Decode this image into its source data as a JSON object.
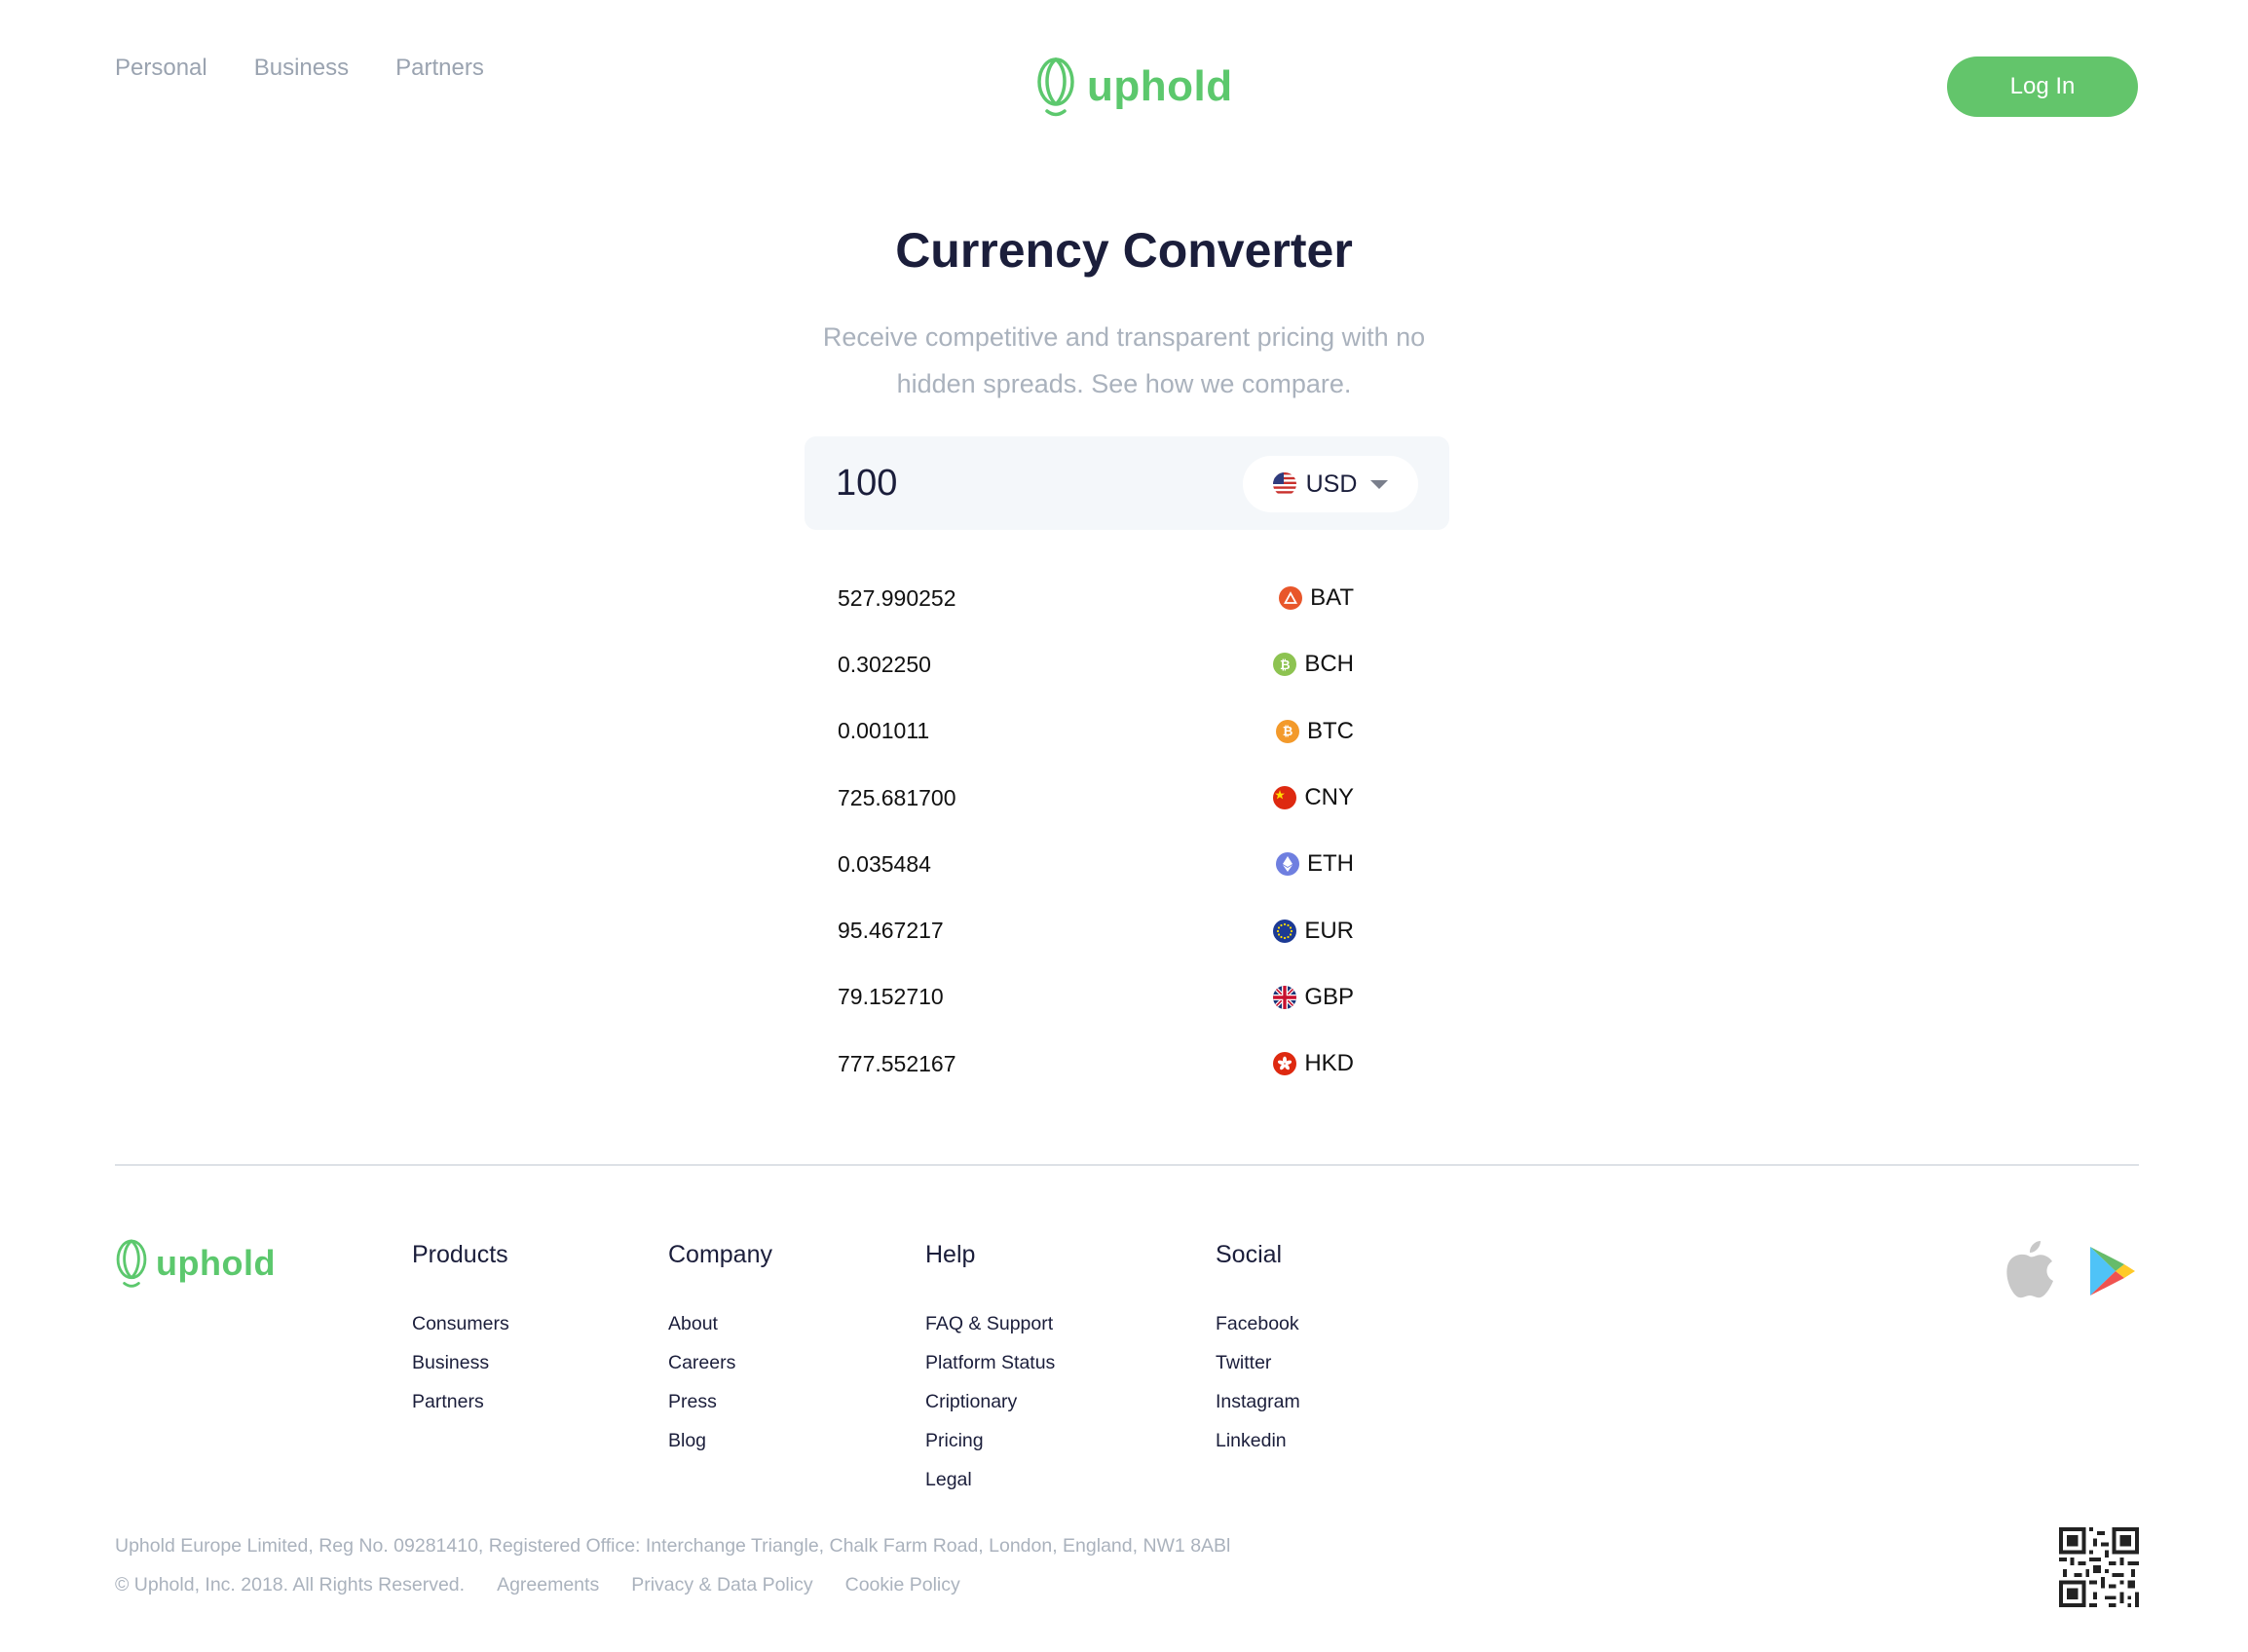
{
  "header": {
    "nav": [
      "Personal",
      "Business",
      "Partners"
    ],
    "logo_text": "uphold",
    "login_label": "Log In"
  },
  "main": {
    "title": "Currency Converter",
    "subtitle": "Receive competitive and transparent pricing with no hidden spreads. See how we compare.",
    "amount": "100",
    "selected_currency": {
      "code": "USD",
      "icon": "us-flag-icon"
    },
    "rates": [
      {
        "value": "527.990252",
        "code": "BAT",
        "icon": "bat-icon",
        "color": "#e8562a"
      },
      {
        "value": "0.302250",
        "code": "BCH",
        "icon": "bch-icon",
        "color": "#8dc351"
      },
      {
        "value": "0.001011",
        "code": "BTC",
        "icon": "btc-icon",
        "color": "#f39a2b"
      },
      {
        "value": "725.681700",
        "code": "CNY",
        "icon": "cn-flag-icon",
        "color": "#de2910"
      },
      {
        "value": "0.035484",
        "code": "ETH",
        "icon": "eth-icon",
        "color": "#6f7fe0"
      },
      {
        "value": "95.467217",
        "code": "EUR",
        "icon": "eu-flag-icon",
        "color": "#1c3a94"
      },
      {
        "value": "79.152710",
        "code": "GBP",
        "icon": "uk-flag-icon",
        "color": "#1a3578"
      },
      {
        "value": "777.552167",
        "code": "HKD",
        "icon": "hk-flag-icon",
        "color": "#de2910"
      }
    ]
  },
  "footer": {
    "logo_text": "uphold",
    "columns": [
      {
        "title": "Products",
        "links": [
          "Consumers",
          "Business",
          "Partners"
        ]
      },
      {
        "title": "Company",
        "links": [
          "About",
          "Careers",
          "Press",
          "Blog"
        ]
      },
      {
        "title": "Help",
        "links": [
          "FAQ & Support",
          "Platform Status",
          "Criptionary",
          "Pricing",
          "Legal"
        ]
      },
      {
        "title": "Social",
        "links": [
          "Facebook",
          "Twitter",
          "Instagram",
          "Linkedin"
        ]
      }
    ],
    "legal_text": "Uphold Europe Limited, Reg No. 09281410, Registered Office: Interchange Triangle, Chalk Farm Road, London, England, NW1 8ABl",
    "copyright": "© Uphold, Inc. 2018. All Rights Reserved.",
    "legal_links": [
      "Agreements",
      "Privacy & Data Policy",
      "Cookie Policy"
    ]
  },
  "colors": {
    "brand_green": "#5cc86d",
    "login_button": "#63c56b",
    "title": "#1b1e3b",
    "muted": "#aab2bd"
  }
}
